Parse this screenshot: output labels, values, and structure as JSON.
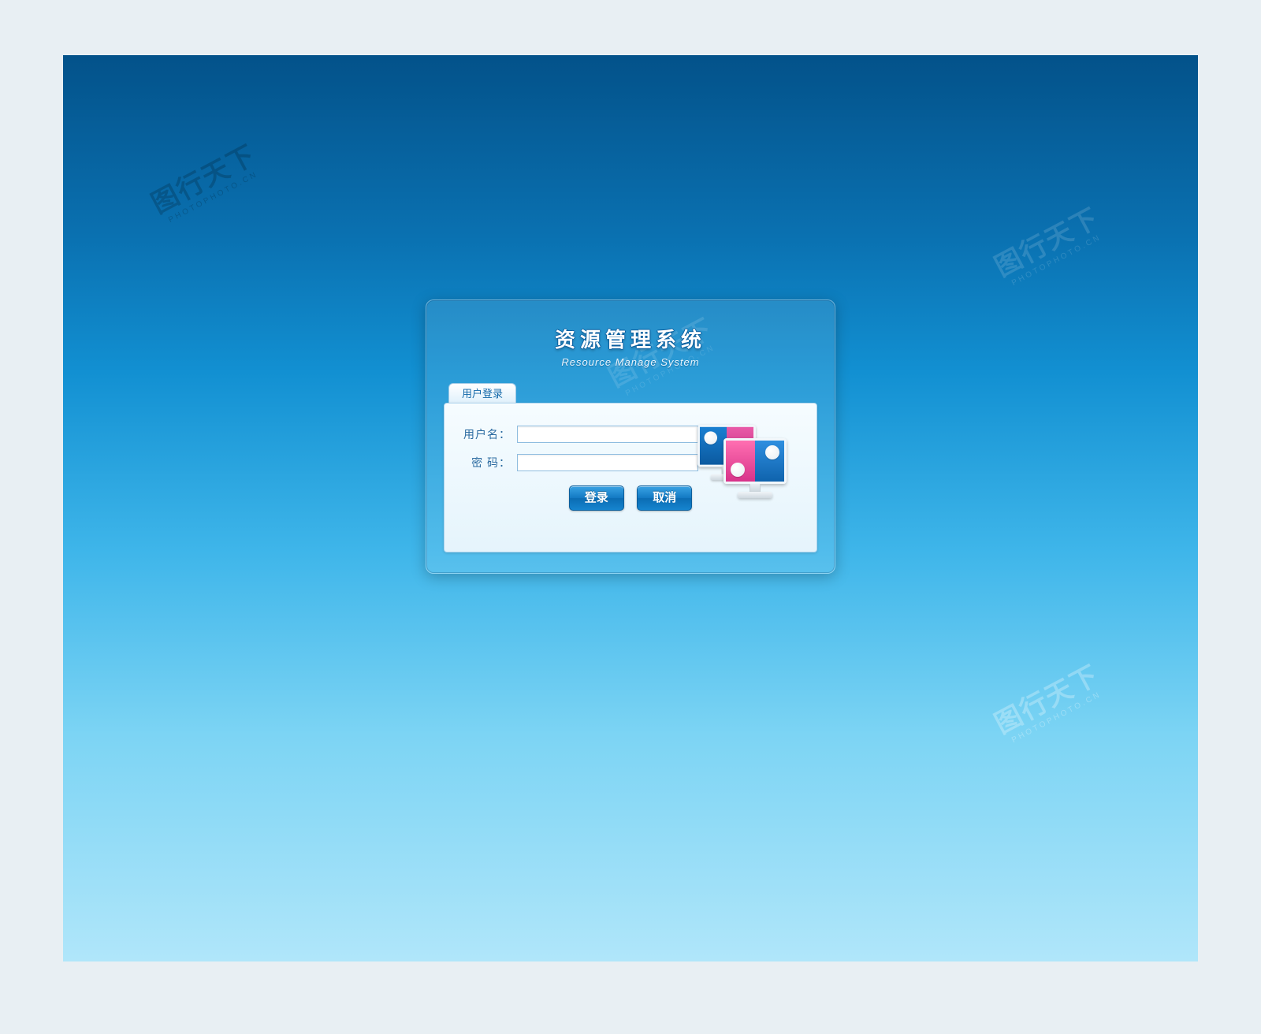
{
  "header": {
    "title_cn": "资源管理系统",
    "title_en": "Resource Manage System"
  },
  "tab": {
    "label": "用户登录"
  },
  "form": {
    "username_label": "用户名：",
    "password_label": "密 码：",
    "username_value": "",
    "password_value": ""
  },
  "buttons": {
    "login": "登录",
    "cancel": "取消"
  },
  "watermark": {
    "text": "图行天下",
    "sub": "PHOTOPHOTO.CN"
  }
}
